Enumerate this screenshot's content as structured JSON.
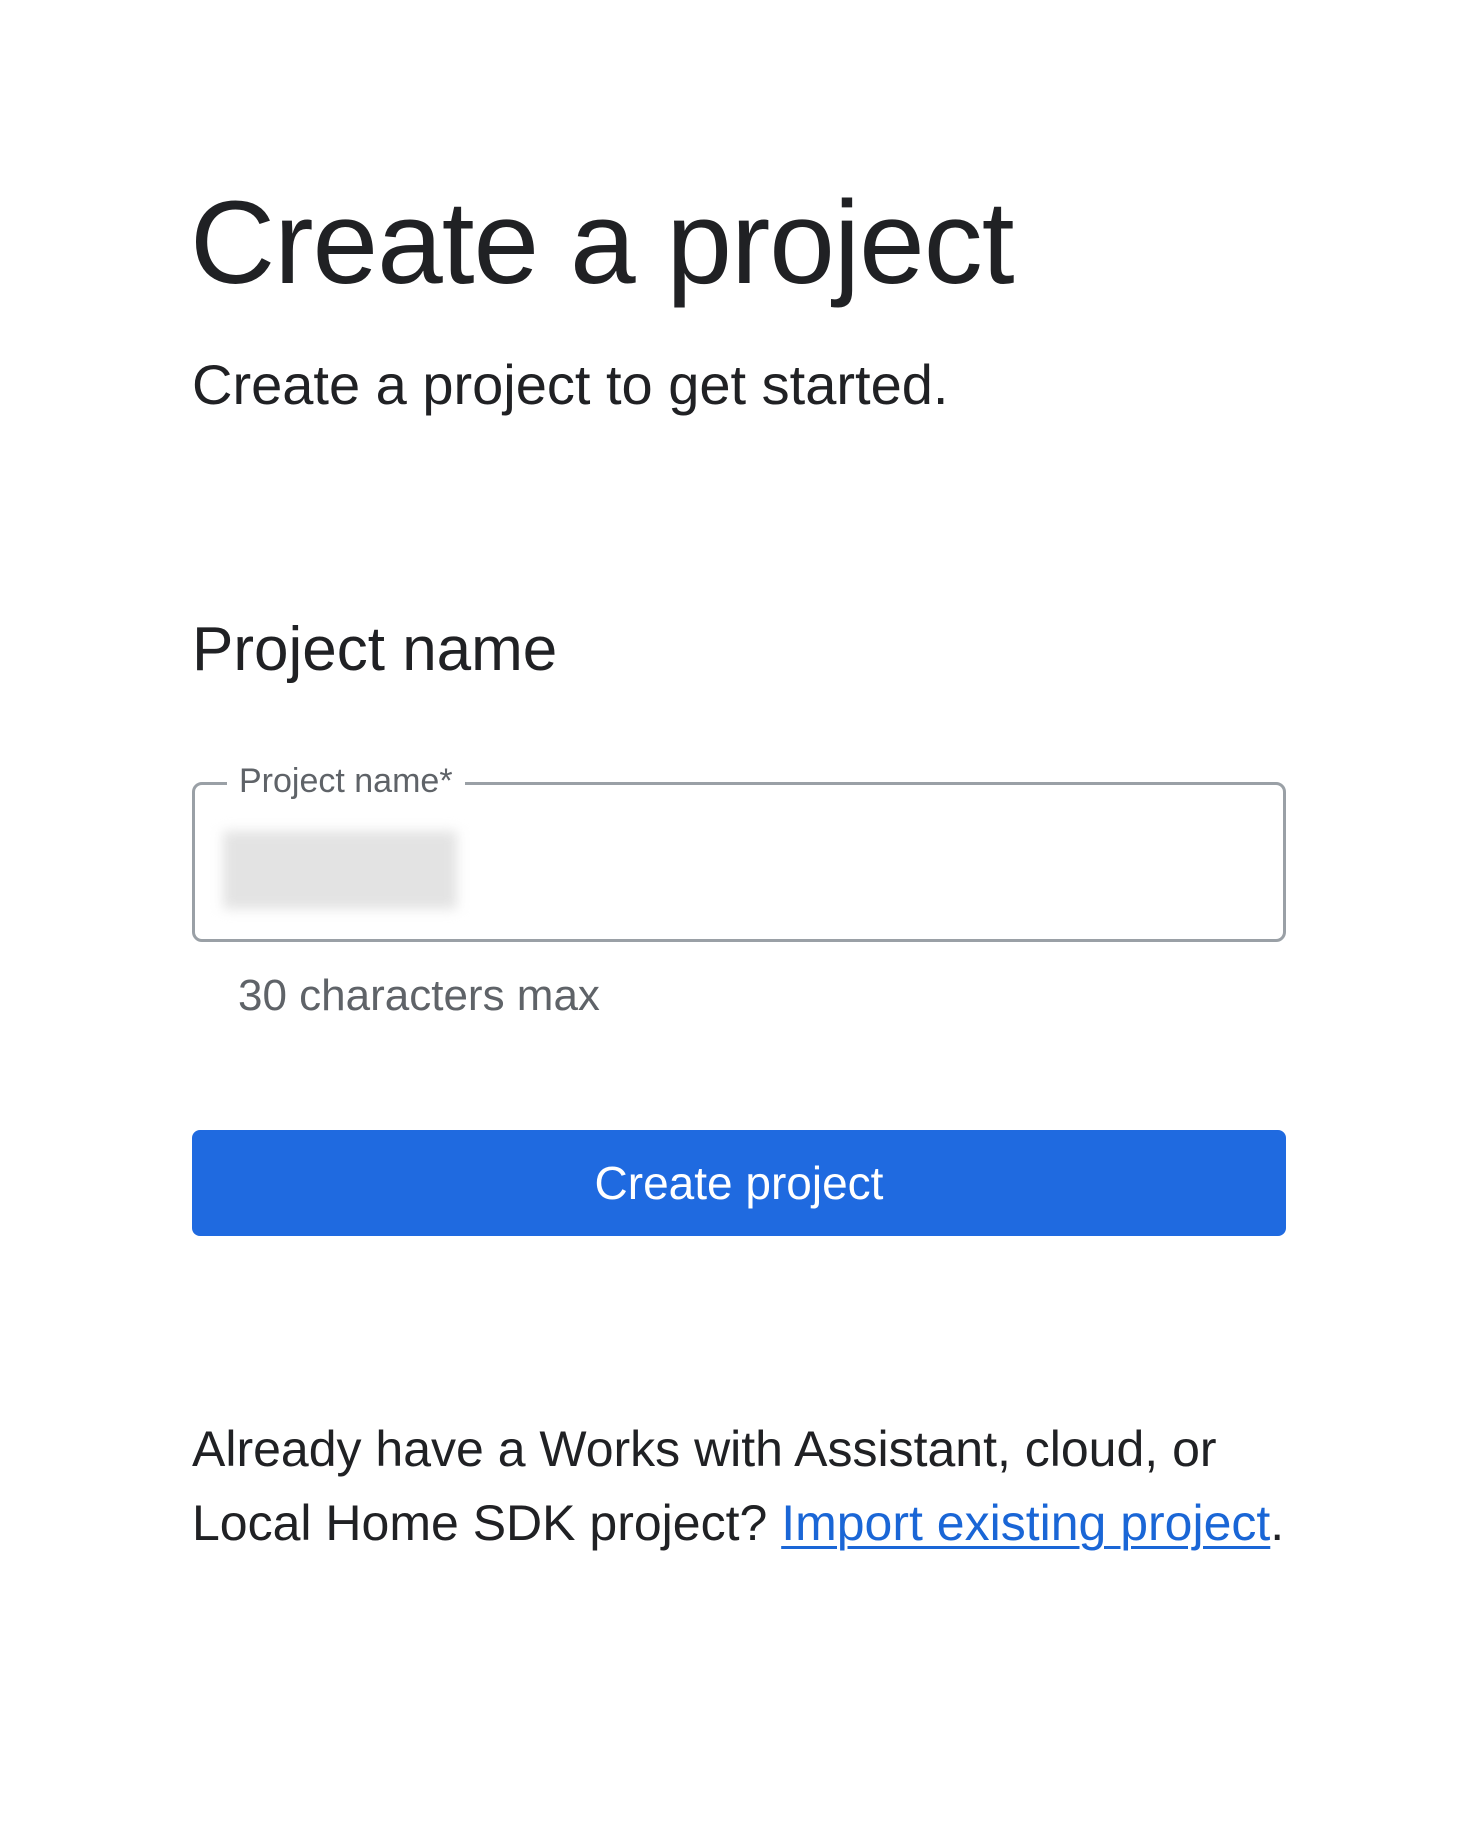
{
  "header": {
    "title": "Create a project",
    "subtitle": "Create a project to get started."
  },
  "form": {
    "section_heading": "Project name",
    "project_name_field": {
      "label": "Project name*",
      "value": "",
      "helper_text": "30 characters max"
    },
    "submit_label": "Create project"
  },
  "footer": {
    "import_prefix": "Already have a Works with Assistant, cloud, or Local Home SDK project?",
    "import_link_label": "Import existing project",
    "import_suffix": "."
  },
  "colors": {
    "primary": "#1f6ae0",
    "link": "#1a66d6",
    "text": "#202124",
    "secondary_text": "#5f6368",
    "field_border": "#9aa0a6"
  }
}
